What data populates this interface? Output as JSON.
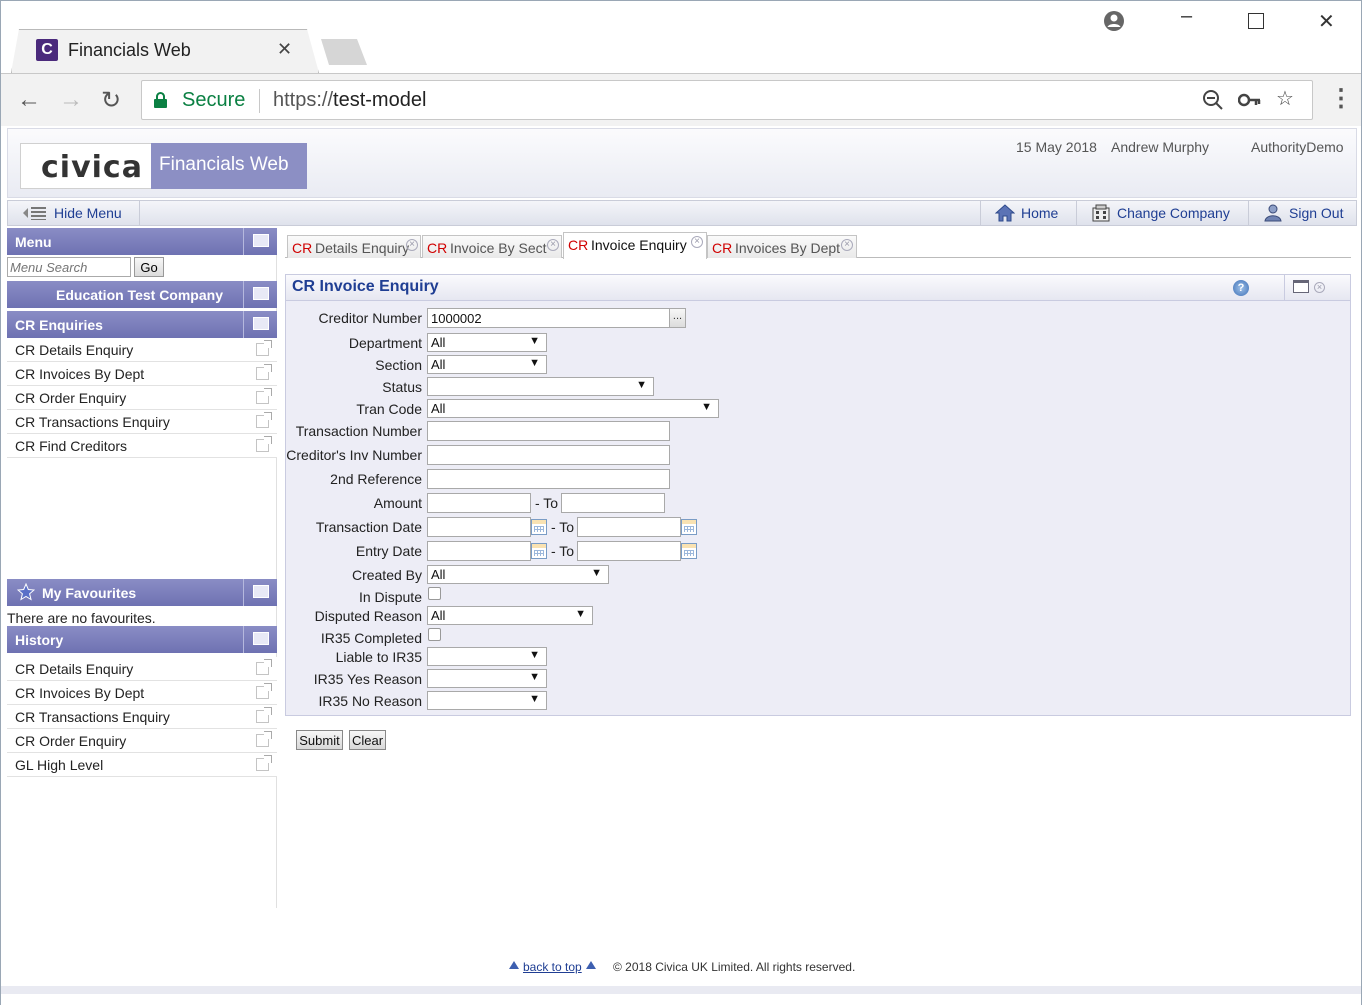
{
  "browser": {
    "tab_title": "Financials Web",
    "tab_close": "✕",
    "secure_label": "Secure",
    "url_scheme": "https://",
    "url_host": "test-model",
    "favicon_letter": "C"
  },
  "header": {
    "logo_text": "civica",
    "product_name": "Financials Web",
    "date": "15 May 2018",
    "user": "Andrew Murphy",
    "authority": "AuthorityDemo"
  },
  "menubar": {
    "hide_menu": "Hide Menu",
    "home": "Home",
    "change_company": "Change Company",
    "sign_out": "Sign Out"
  },
  "sidebar": {
    "menu_title": "Menu",
    "search_placeholder": "Menu Search",
    "go_label": "Go",
    "company": "Education Test Company",
    "enquiries_title": "CR Enquiries",
    "enquiries": [
      "CR Details Enquiry",
      "CR Invoices By Dept",
      "CR Order Enquiry",
      "CR Transactions Enquiry",
      "CR Find Creditors"
    ],
    "favourites_title": "My Favourites",
    "no_favourites": "There are no favourites.",
    "history_title": "History",
    "history": [
      "CR Details Enquiry",
      "CR Invoices By Dept",
      "CR Transactions Enquiry",
      "CR Order Enquiry",
      "GL High Level"
    ]
  },
  "tabs": [
    {
      "prefix": "CR",
      "label": "Details Enquiry"
    },
    {
      "prefix": "CR",
      "label": "Invoice By Sect"
    },
    {
      "prefix": "CR",
      "label": "Invoice Enquiry"
    },
    {
      "prefix": "CR",
      "label": "Invoices By Dept"
    }
  ],
  "form": {
    "title": "CR Invoice Enquiry",
    "help": "?",
    "ellipsis": "...",
    "to": "- To",
    "labels": {
      "creditor_number": "Creditor Number",
      "department": "Department",
      "section": "Section",
      "status": "Status",
      "tran_code": "Tran Code",
      "transaction_number": "Transaction Number",
      "creditors_inv_number": "Creditor's Inv Number",
      "second_reference": "2nd Reference",
      "amount": "Amount",
      "transaction_date": "Transaction Date",
      "entry_date": "Entry Date",
      "created_by": "Created By",
      "in_dispute": "In Dispute",
      "disputed_reason": "Disputed Reason",
      "ir35_completed": "IR35 Completed",
      "liable_to_ir35": "Liable to IR35",
      "ir35_yes_reason": "IR35 Yes Reason",
      "ir35_no_reason": "IR35 No Reason"
    },
    "values": {
      "creditor_number": "1000002",
      "department": "All",
      "section": "All",
      "status": "",
      "tran_code": "All",
      "created_by": "All",
      "disputed_reason": "All",
      "liable_to_ir35": "",
      "ir35_yes_reason": "",
      "ir35_no_reason": ""
    },
    "submit": "Submit",
    "clear": "Clear"
  },
  "footer": {
    "back_to_top": "back to top",
    "copyright": "© 2018 Civica UK Limited. All rights reserved."
  }
}
